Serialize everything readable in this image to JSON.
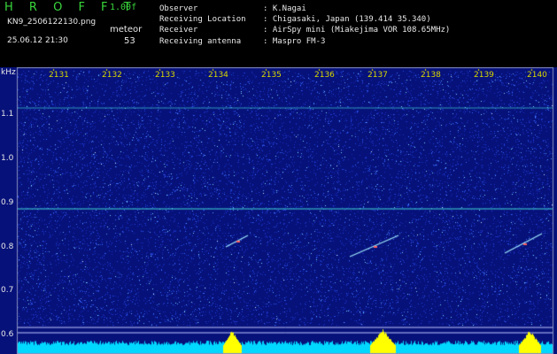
{
  "header": {
    "app_title": "H R O F F T",
    "version": "1.00f",
    "filename": "KN9_2506122130.png",
    "timestamp": "25.06.12 21:30",
    "meteor_label": "meteor",
    "meteor_count": "53",
    "info_rows": [
      {
        "key": "Observer",
        "value": ": K.Nagai"
      },
      {
        "key": "Receiving Location",
        "value": ": Chigasaki, Japan (139.414 35.340)"
      },
      {
        "key": "Receiver",
        "value": ": AirSpy mini (Miakejima VOR 108.65MHz)"
      },
      {
        "key": "Receiving antenna",
        "value": ": Maspro FM-3"
      }
    ]
  },
  "axis": {
    "y_unit": "kHz",
    "y_ticks": [
      "1.1",
      "1.0",
      "0.9",
      "0.8",
      "0.7",
      "0.6"
    ],
    "x_ticks": [
      "2131",
      "2132",
      "2133",
      "2134",
      "2135",
      "2136",
      "2137",
      "2138",
      "2139",
      "2140"
    ]
  },
  "colors": {
    "background": "#06117a",
    "text_green": "#39d63c",
    "tick_yellow": "#d8d800",
    "carrier_line": "#3fd0d0",
    "bottom_bar": "#00d8ff",
    "bottom_peak": "#ffff00"
  }
}
